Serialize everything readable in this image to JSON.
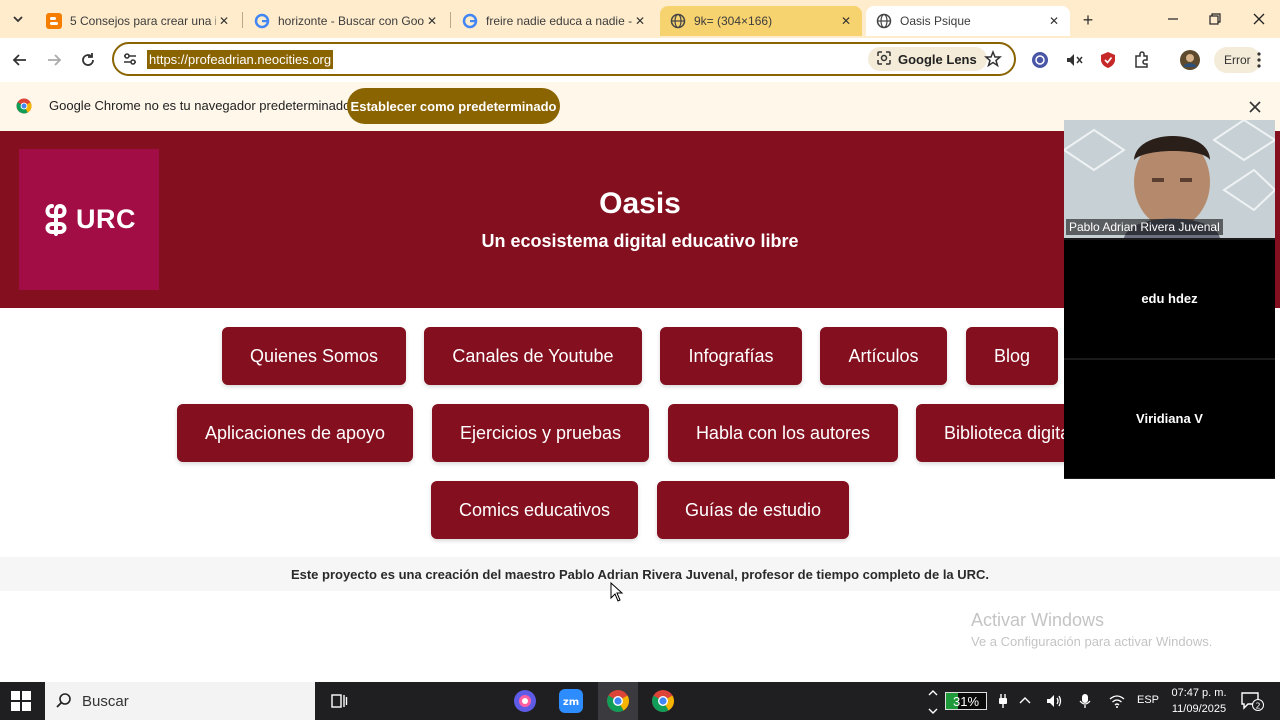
{
  "browser": {
    "tabs": [
      {
        "title": "5 Consejos para crear una in",
        "favicon": "blogger-icon"
      },
      {
        "title": "horizonte - Buscar con Goog",
        "favicon": "google-icon"
      },
      {
        "title": "freire nadie educa a nadie -",
        "favicon": "google-icon"
      },
      {
        "title": "9k= (304×166)",
        "favicon": "globe-icon"
      },
      {
        "title": "Oasis Psique",
        "favicon": "globe-icon"
      }
    ],
    "url": "https://profeadrian.neocities.org",
    "lens_label": "Google Lens",
    "profile_label": "Error",
    "infobar_text": "Google Chrome no es tu navegador predeterminado",
    "infobar_button": "Establecer como predeterminado"
  },
  "site": {
    "logo_text": "URC",
    "title": "Oasis",
    "subtitle": "Un ecosistema digital educativo libre",
    "buttons": [
      "Quienes Somos",
      "Canales de Youtube",
      "Infografías",
      "Artículos",
      "Blog",
      "Aplicaciones de apoyo",
      "Ejercicios y pruebas",
      "Habla con los autores",
      "Biblioteca digital",
      "Comics educativos",
      "Guías de estudio"
    ],
    "footer": "Este proyecto es una creación del maestro Pablo Adrian Rivera Juvenal, profesor de tiempo completo de la URC."
  },
  "video": {
    "participants": [
      "Pablo Adrian Rivera Juvenal",
      "edu hdez",
      "Viridiana V"
    ]
  },
  "watermark": {
    "title": "Activar Windows",
    "subtitle": "Ve a Configuración para activar Windows."
  },
  "taskbar": {
    "search_placeholder": "Buscar",
    "battery_percent": "31%",
    "language": "ESP",
    "time": "07:47 p. m.",
    "date": "11/09/2025",
    "notification_count": "2"
  },
  "colors": {
    "brand": "#840f1f",
    "logo": "#a20d45",
    "chrome_accent": "#8a6400"
  }
}
